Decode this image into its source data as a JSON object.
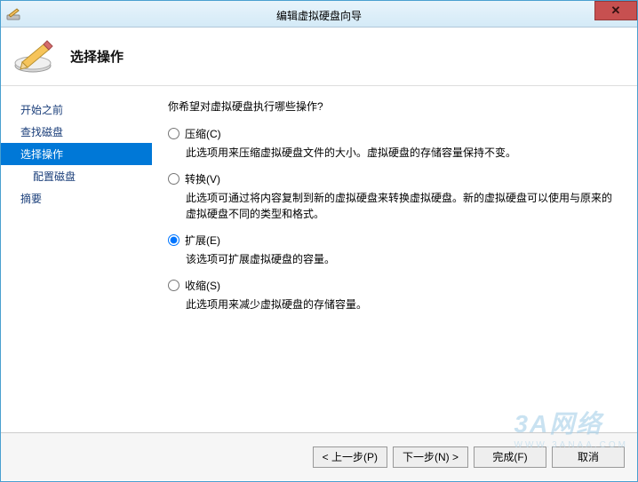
{
  "window": {
    "title": "编辑虚拟硬盘向导"
  },
  "header": {
    "title": "选择操作"
  },
  "sidebar": {
    "items": [
      {
        "label": "开始之前",
        "selected": false,
        "indent": false
      },
      {
        "label": "查找磁盘",
        "selected": false,
        "indent": false
      },
      {
        "label": "选择操作",
        "selected": true,
        "indent": false
      },
      {
        "label": "配置磁盘",
        "selected": false,
        "indent": true
      },
      {
        "label": "摘要",
        "selected": false,
        "indent": false
      }
    ]
  },
  "content": {
    "prompt": "你希望对虚拟硬盘执行哪些操作?",
    "options": [
      {
        "key": "compress",
        "label": "压缩(C)",
        "desc": "此选项用来压缩虚拟硬盘文件的大小。虚拟硬盘的存储容量保持不变。",
        "checked": false
      },
      {
        "key": "convert",
        "label": "转换(V)",
        "desc": "此选项可通过将内容复制到新的虚拟硬盘来转换虚拟硬盘。新的虚拟硬盘可以使用与原来的虚拟硬盘不同的类型和格式。",
        "checked": false
      },
      {
        "key": "expand",
        "label": "扩展(E)",
        "desc": "该选项可扩展虚拟硬盘的容量。",
        "checked": true
      },
      {
        "key": "shrink",
        "label": "收缩(S)",
        "desc": "此选项用来减少虚拟硬盘的存储容量。",
        "checked": false
      }
    ]
  },
  "footer": {
    "prev": "< 上一步(P)",
    "next": "下一步(N) >",
    "finish": "完成(F)",
    "cancel": "取消"
  },
  "watermark": {
    "main": "3A网络",
    "sub": "WWW.3ANAA.COM"
  }
}
